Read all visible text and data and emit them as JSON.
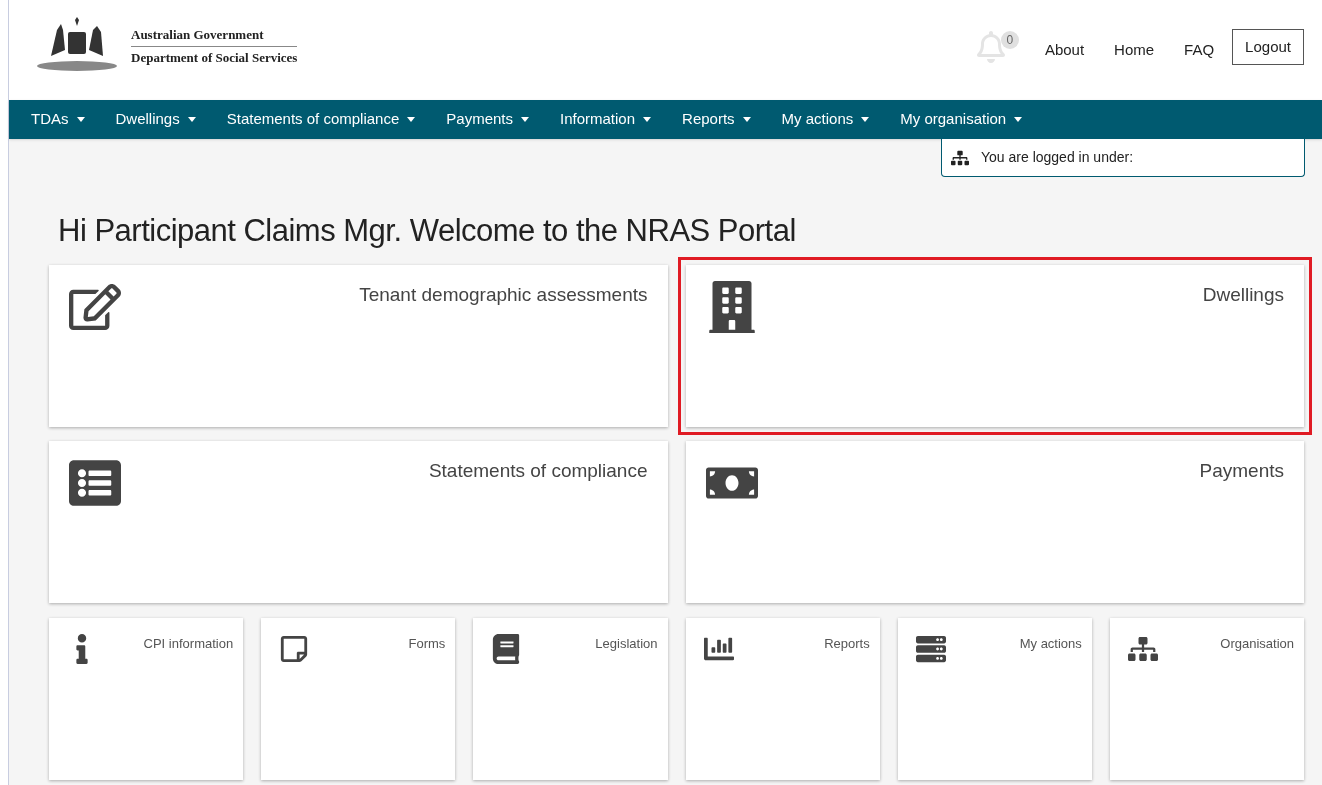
{
  "header": {
    "logo_line1": "Australian Government",
    "logo_line2": "Department of Social Services",
    "notifications": "0",
    "links": [
      "About",
      "Home",
      "FAQ"
    ],
    "logout": "Logout"
  },
  "nav": [
    "TDAs",
    "Dwellings",
    "Statements of compliance",
    "Payments",
    "Information",
    "Reports",
    "My actions",
    "My organisation"
  ],
  "logged_in": "You are logged in under:",
  "welcome": "Hi Participant Claims Mgr. Welcome to the NRAS Portal",
  "large_tiles": [
    {
      "title": "Tenant demographic assessments",
      "highlighted": false
    },
    {
      "title": "Dwellings",
      "highlighted": true
    },
    {
      "title": "Statements of compliance",
      "highlighted": false
    },
    {
      "title": "Payments",
      "highlighted": false
    }
  ],
  "small_tiles": [
    {
      "title": "CPI information"
    },
    {
      "title": "Forms"
    },
    {
      "title": "Legislation"
    },
    {
      "title": "Reports"
    },
    {
      "title": "My actions"
    },
    {
      "title": "Organisation"
    }
  ]
}
